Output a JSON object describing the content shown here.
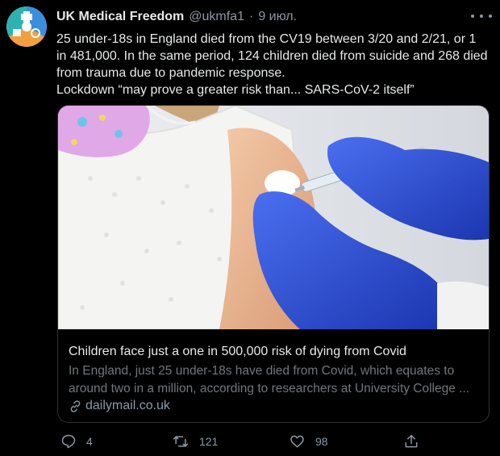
{
  "author": {
    "name": "UK Medical Freedom",
    "handle": "@ukmfa1",
    "separator": "·",
    "date": "9 июл."
  },
  "tweet": {
    "paragraphs": [
      "25 under-18s in England died from the CV19 between 3/20 and 2/21, or 1 in 481,000. In the same period, 124 children died from suicide and 268 died from trauma due to pandemic response.",
      "Lockdown “may prove a greater risk than... SARS-CoV-2 itself”"
    ]
  },
  "card": {
    "title": "Children face just a one in 500,000 risk of dying from Covid",
    "description": "In England, just 25 under-18s have died from Covid, which equates to around two in a million, according to researchers at University College ...",
    "domain": "dailymail.co.uk"
  },
  "actions": {
    "replies": "4",
    "retweets": "121",
    "likes": "98"
  },
  "colors": {
    "background": "#000000",
    "text": "#e7e9ea",
    "muted": "#8b98a5",
    "border": "#2f3336",
    "glove": "#2b4fd6",
    "avatar_teal": "#2eb2b0",
    "avatar_orange": "#f2a03d",
    "avatar_blue": "#3a8fdc"
  },
  "icons": [
    "avatar-logo",
    "more-icon",
    "link-icon",
    "reply-icon",
    "retweet-icon",
    "like-icon",
    "share-icon"
  ]
}
